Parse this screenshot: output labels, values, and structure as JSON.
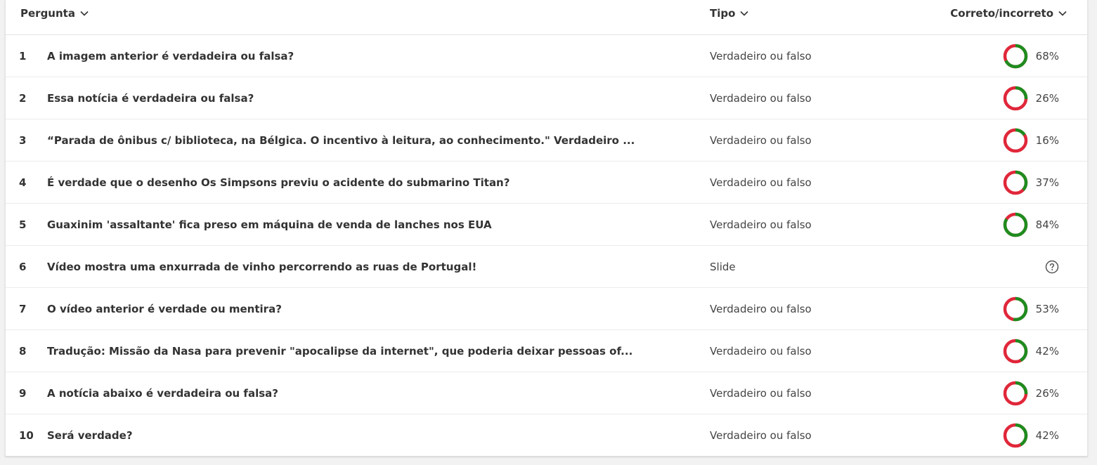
{
  "header": {
    "question_label": "Pergunta",
    "type_label": "Tipo",
    "correct_label": "Correto/incorreto"
  },
  "colors": {
    "correct": "#1e8c1e",
    "incorrect": "#e0273a"
  },
  "rows": [
    {
      "num": "1",
      "question": "A imagem anterior é verdadeira ou falsa?",
      "type": "Verdadeiro ou falso",
      "percent": "68%",
      "correct_fraction": 0.68
    },
    {
      "num": "2",
      "question": "Essa notícia é verdadeira ou falsa?",
      "type": "Verdadeiro ou falso",
      "percent": "26%",
      "correct_fraction": 0.26
    },
    {
      "num": "3",
      "question": "“Parada de ônibus c/ biblioteca, na Bélgica. O incentivo à leitura, ao conhecimento.\" Verdadeiro ...",
      "type": "Verdadeiro ou falso",
      "percent": "16%",
      "correct_fraction": 0.16
    },
    {
      "num": "4",
      "question": "É verdade que o desenho Os Simpsons previu o acidente do submarino Titan?",
      "type": "Verdadeiro ou falso",
      "percent": "37%",
      "correct_fraction": 0.37
    },
    {
      "num": "5",
      "question": "Guaxinim 'assaltante' fica preso em máquina de venda de lanches nos EUA",
      "type": "Verdadeiro ou falso",
      "percent": "84%",
      "correct_fraction": 0.84
    },
    {
      "num": "6",
      "question": "Vídeo mostra uma enxurrada de vinho percorrendo as ruas de Portugal!",
      "type": "Slide",
      "percent": null,
      "correct_fraction": null,
      "icon": "help-circle-icon"
    },
    {
      "num": "7",
      "question": "O vídeo anterior é verdade ou mentira?",
      "type": "Verdadeiro ou falso",
      "percent": "53%",
      "correct_fraction": 0.53
    },
    {
      "num": "8",
      "question": "Tradução: Missão da Nasa para prevenir \"apocalipse da internet\", que poderia deixar pessoas of...",
      "type": "Verdadeiro ou falso",
      "percent": "42%",
      "correct_fraction": 0.42
    },
    {
      "num": "9",
      "question": "A notícia abaixo é verdadeira ou falsa?",
      "type": "Verdadeiro ou falso",
      "percent": "26%",
      "correct_fraction": 0.26
    },
    {
      "num": "10",
      "question": "Será verdade?",
      "type": "Verdadeiro ou falso",
      "percent": "42%",
      "correct_fraction": 0.42
    }
  ]
}
